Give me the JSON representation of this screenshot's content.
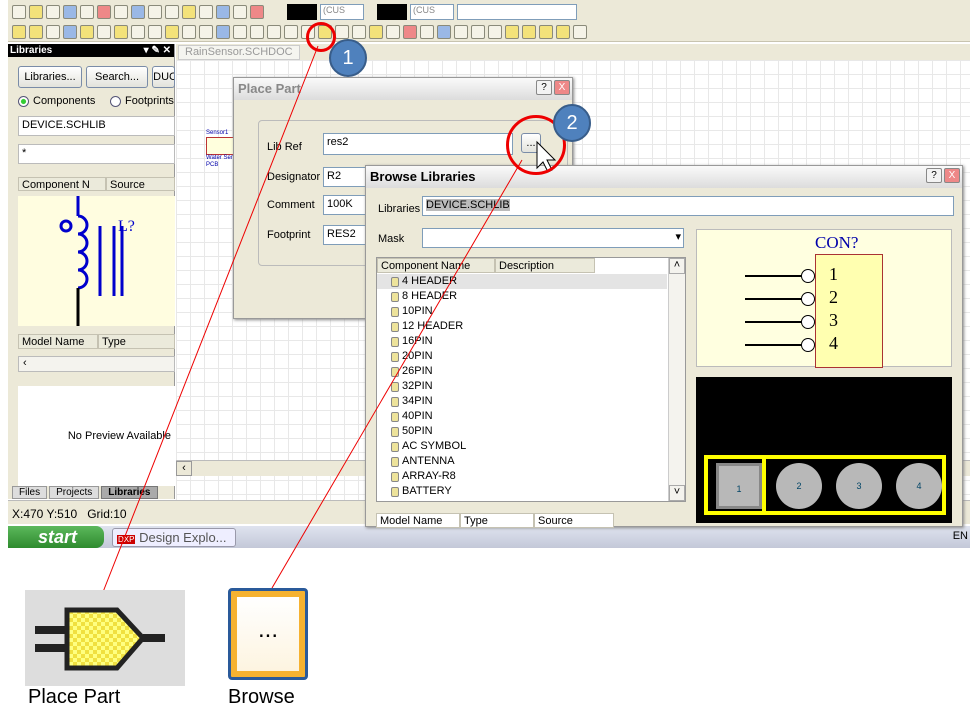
{
  "toolbar": {
    "color_combo_1": "(CUS",
    "color_combo_2": "(CUS"
  },
  "libraries_panel": {
    "title": "Libraries",
    "libraries_button": "Libraries...",
    "search_button": "Search...",
    "place_button": "IDUC",
    "radio_components": "Components",
    "radio_footprints": "Footprints",
    "library_value": "DEVICE.SCHLIB",
    "filter_value": "*",
    "col_component": "Component N",
    "col_source": "Source",
    "preview_designator": "L?",
    "col_model_name": "Model Name",
    "col_type": "Type",
    "no_preview": "No Preview Available",
    "tabs": [
      "Files",
      "Projects",
      "Libraries"
    ]
  },
  "document": {
    "tab": "RainSensor.SCHDOC",
    "sheet_labels": [
      "Sensor1",
      "Water Sen",
      "PCB"
    ]
  },
  "place_part": {
    "title": "Place Part",
    "lib_ref_label": "Lib Ref",
    "lib_ref": "res2",
    "designator_label": "Designator",
    "designator": "R2",
    "comment_label": "Comment",
    "comment": "100K",
    "footprint_label": "Footprint",
    "footprint": "RES2",
    "browse_button": "...",
    "help": "?",
    "close": "X"
  },
  "browse_libraries": {
    "title": "Browse Libraries",
    "libraries_label": "Libraries",
    "libraries_value": "DEVICE.SCHLIB",
    "mask_label": "Mask",
    "mask_value": "",
    "col_name": "Component Name",
    "col_desc": "Description",
    "components": [
      "4 HEADER",
      "8 HEADER",
      "10PIN",
      "12 HEADER",
      "16PIN",
      "20PIN",
      "26PIN",
      "32PIN",
      "34PIN",
      "40PIN",
      "50PIN",
      "AC SYMBOL",
      "ANTENNA",
      "ARRAY-R8",
      "BATTERY"
    ],
    "preview_designator": "CON?",
    "pins": [
      "1",
      "2",
      "3",
      "4"
    ],
    "pads": [
      "1",
      "2",
      "3",
      "4"
    ],
    "bottom_cols": [
      "Model Name",
      "Type",
      "Source"
    ],
    "help": "?",
    "close": "X"
  },
  "status": {
    "coords": "X:470 Y:510",
    "grid": "Grid:10"
  },
  "taskbar": {
    "start": "start",
    "task": "Design Explo...",
    "lang": "EN"
  },
  "callouts": [
    "1",
    "2"
  ],
  "legend": {
    "place_part": "Place Part",
    "browse": "Browse",
    "browse_glyph": "..."
  }
}
